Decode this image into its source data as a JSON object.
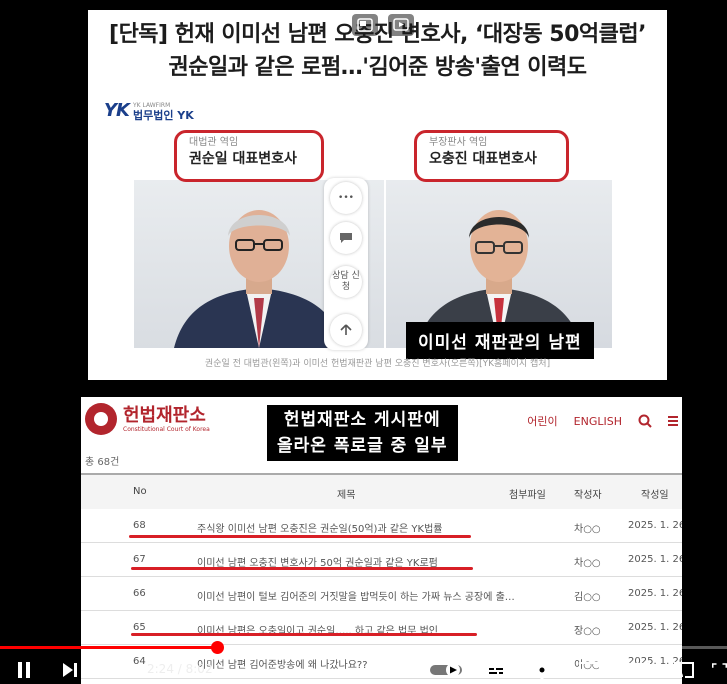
{
  "news": {
    "headline_line1": "[단독] 헌재 이미선 남편 오충진 변호사, ‘대장동 50억클럽’",
    "headline_line2": "권순일과 같은 로펌…'김어준 방송'출연 이력도",
    "logo_small": "YK LAWFIRM",
    "logo_name": "법무법인 YK",
    "left_role": "대법관 역임",
    "left_name": "권순일 대표변호사",
    "right_role": "부장판사 역임",
    "right_name": "오충진 대표변호사",
    "side_consult": "상담 신청",
    "caption": "이미선 재판관의 남편",
    "photo_credit": "권순일 전 대법관(왼쪽)과 이미선 헌법재판관 남편 오충진 변호사(오른쪽)[YK홈페이지 캡처]"
  },
  "court": {
    "name": "헌법재판소",
    "name_en": "Constitutional Court of Korea",
    "nav": [
      "어린이",
      "ENGLISH"
    ],
    "caption_line1": "헌법재판소 게시판에",
    "caption_line2": "올라온 폭로글 중 일부",
    "total": "총 68건",
    "headers": {
      "no": "No",
      "title": "제목",
      "file": "첨부파일",
      "author": "작성자",
      "date": "작성일"
    },
    "rows": [
      {
        "no": "68",
        "title": "주식왕 이미선 남편 오충진은 권순일(50억)과 같은 YK법률",
        "author": "차○○",
        "date": "2025. 1. 26."
      },
      {
        "no": "67",
        "title": "이미선 남편 오충진 변호사가 50억 권순일과 같은 YK로펌",
        "author": "차○○",
        "date": "2025. 1. 26."
      },
      {
        "no": "66",
        "title": "이미선 남편이 털보 김어준의 거짓말을 밥먹듯이 하는 가짜 뉴스 공장에 출…",
        "author": "김○○",
        "date": "2025. 1. 26."
      },
      {
        "no": "65",
        "title": "이미선 남편은 오충일이고 권순일….. 하고 같은 법무 법인",
        "author": "장○○",
        "date": "2025. 1. 26."
      },
      {
        "no": "64",
        "title": "이미선 남편 김어준방송에 왜 나갔나요??",
        "author": "이○○",
        "date": "2025. 1. 26."
      }
    ]
  },
  "player": {
    "current_time": "2:24",
    "separator": " / ",
    "duration": "8:02",
    "played_fraction": 0.299,
    "buffered_fraction": 0.575,
    "accent": "#ff0000"
  },
  "icons": [
    "pip-icon",
    "cast-icon",
    "pause-icon",
    "next-icon",
    "volume-icon",
    "autoplay-toggle-icon",
    "subtitles-icon",
    "settings-icon",
    "miniplayer-icon",
    "theater-icon",
    "cast-screen-icon",
    "fullscreen-icon",
    "search-icon",
    "menu-icon"
  ]
}
